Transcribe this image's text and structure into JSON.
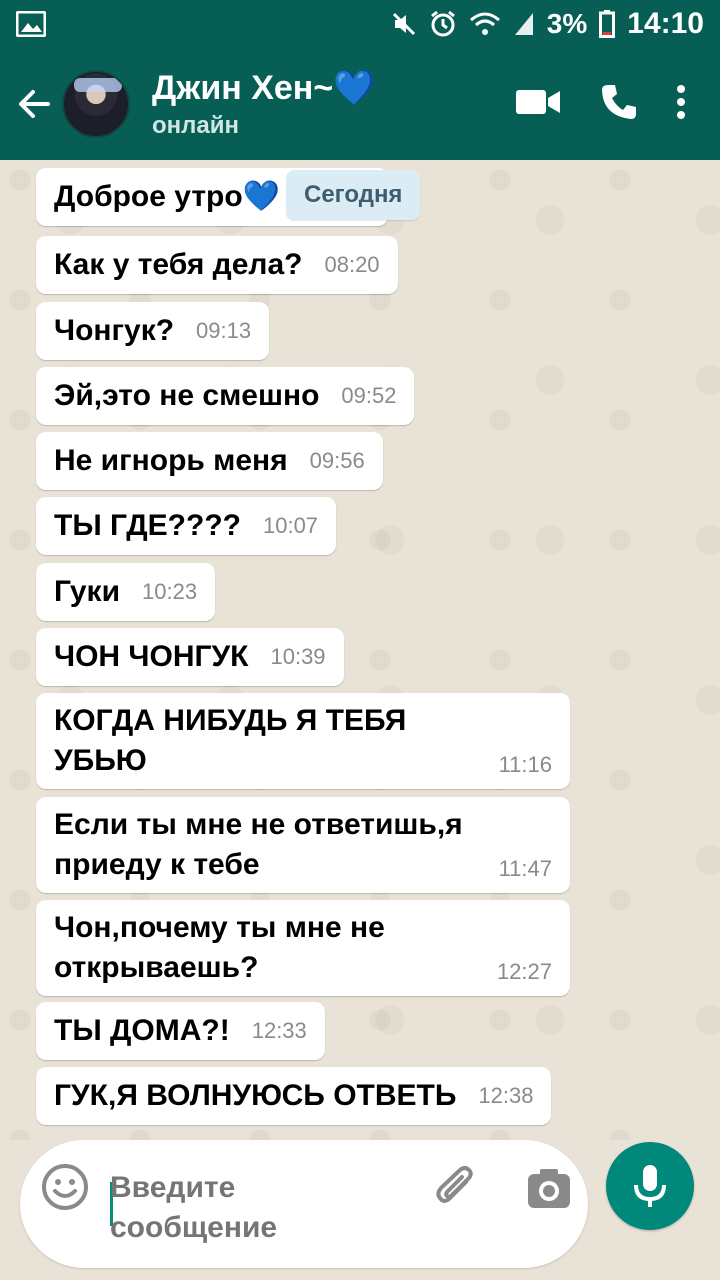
{
  "status_bar": {
    "battery": "3%",
    "time": "14:10",
    "icons": [
      "image-icon",
      "mute-icon",
      "alarm-icon",
      "wifi-icon",
      "signal-icon",
      "battery-icon"
    ]
  },
  "header": {
    "contact_name": "Джин Хен~💙",
    "status": "онлайн",
    "icons": [
      "back-arrow-icon",
      "video-call-icon",
      "phone-icon",
      "more-vert-icon"
    ]
  },
  "chat": {
    "date_label": "Сегодня",
    "messages": [
      {
        "text": "Доброе утро💙",
        "time": ""
      },
      {
        "text": "Как у тебя дела?",
        "time": "08:20"
      },
      {
        "text": "Чонгук?",
        "time": "09:13"
      },
      {
        "text": "Эй,это не смешно",
        "time": "09:52"
      },
      {
        "text": "Не игнорь меня",
        "time": "09:56"
      },
      {
        "text": "ТЫ ГДЕ????",
        "time": "10:07"
      },
      {
        "text": "Гуки",
        "time": "10:23"
      },
      {
        "text": "ЧОН ЧОНГУК",
        "time": "10:39"
      },
      {
        "text_line1": "КОГДА НИБУДЬ Я ТЕБЯ",
        "text_line2": "УБЬЮ",
        "time": "11:16"
      },
      {
        "text_line1": "Если ты мне не ответишь,я",
        "text_line2": "приеду к тебе",
        "time": "11:47"
      },
      {
        "text_line1": "Чон,почему ты мне не",
        "text_line2": "открываешь?",
        "time": "12:27"
      },
      {
        "text": "ТЫ ДОМА?!",
        "time": "12:33"
      },
      {
        "text": "ГУК,Я ВОЛНУЮСЬ ОТВЕТЬ",
        "time": "12:38"
      }
    ]
  },
  "input": {
    "placeholder": "Введите сообщение",
    "icons": [
      "emoji-icon",
      "attach-icon",
      "camera-icon",
      "mic-icon"
    ]
  },
  "colors": {
    "header": "#075e54",
    "accent": "#00897b",
    "chat_bg": "#e9e2d6",
    "bubble": "#ffffff",
    "date_pill": "#dcecf5"
  }
}
